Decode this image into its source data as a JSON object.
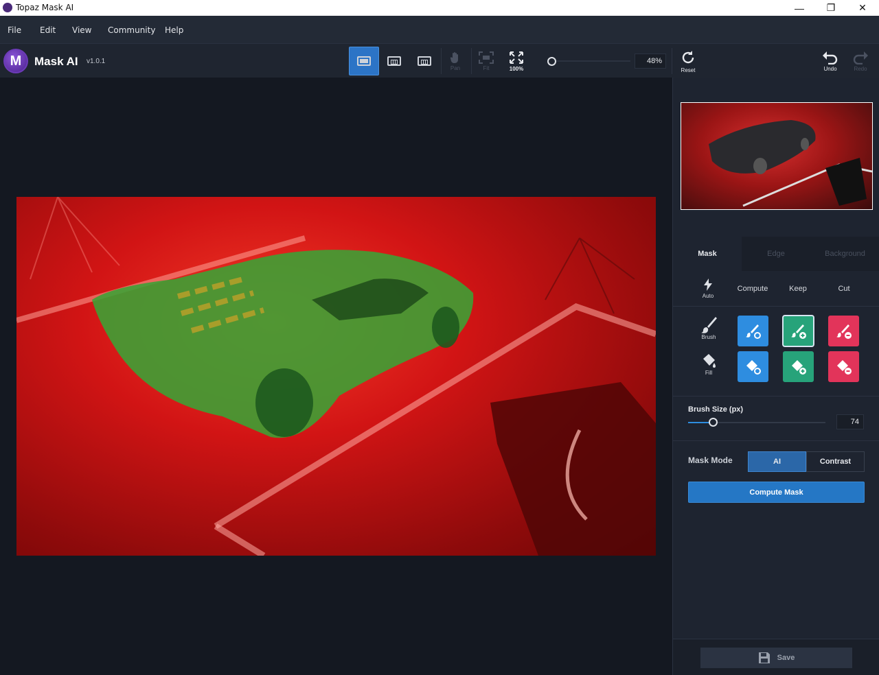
{
  "window": {
    "title": "Topaz Mask AI",
    "minimize": "—",
    "maximize": "❐",
    "close": "✕"
  },
  "menu": [
    "File",
    "Edit",
    "View",
    "Community",
    "Help"
  ],
  "brand": {
    "name": "Mask AI",
    "version": "v1.0.1",
    "logo_letter": "M"
  },
  "toolbar": {
    "pan_label": "Pan",
    "fit_label": "Fit",
    "zoom100_label": "100%",
    "zoom_value": "48%",
    "reset_label": "Reset",
    "undo_label": "Undo",
    "redo_label": "Redo"
  },
  "panel": {
    "tabs": [
      "Mask",
      "Edge",
      "Background"
    ],
    "modes": {
      "auto": "Auto",
      "compute": "Compute",
      "keep": "Keep",
      "cut": "Cut"
    },
    "tools": {
      "brush": "Brush",
      "fill": "Fill"
    },
    "brush_size_label": "Brush Size (px)",
    "brush_size_value": "74",
    "brush_size_fraction": 0.18,
    "mask_mode_label": "Mask Mode",
    "mask_mode_options": [
      "AI",
      "Contrast"
    ],
    "compute_mask_label": "Compute Mask",
    "save_label": "Save"
  },
  "colors": {
    "accent_blue": "#2e8de0",
    "keep_green": "#27a37a",
    "cut_red": "#e2345a",
    "mask_red": "#cc1414",
    "mask_green": "#3aa336"
  }
}
